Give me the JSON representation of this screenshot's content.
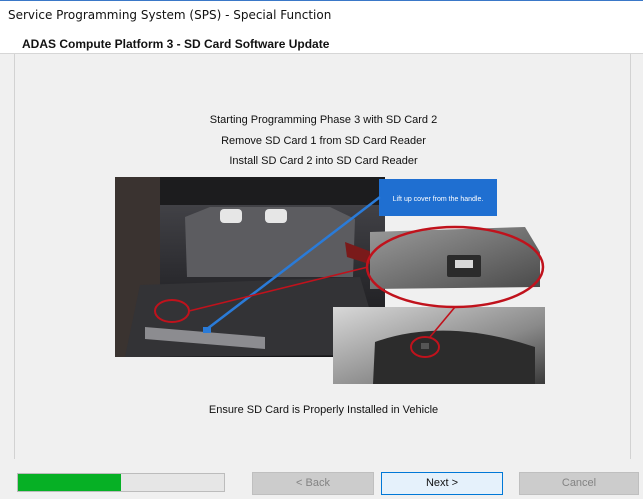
{
  "window": {
    "title": "Service Programming System (SPS) - Special Function"
  },
  "header": {
    "title": "ADAS Compute Platform 3 - SD Card Software Update"
  },
  "instructions": [
    "Starting Programming Phase 3 with SD Card 2",
    "Remove SD Card 1 from SD Card Reader",
    "Install SD Card 2 into SD Card Reader"
  ],
  "figure": {
    "callout_text": "Lift up cover from the handle."
  },
  "footer_message": "Ensure SD Card is Properly Installed in Vehicle",
  "progress": {
    "fraction": 0.5
  },
  "buttons": {
    "back_label": "< Back",
    "next_label": "Next >",
    "cancel_label": "Cancel"
  },
  "colors": {
    "progress_green": "#06b025",
    "callout_blue": "#1f6fd1",
    "highlight_red": "#c0121c"
  }
}
